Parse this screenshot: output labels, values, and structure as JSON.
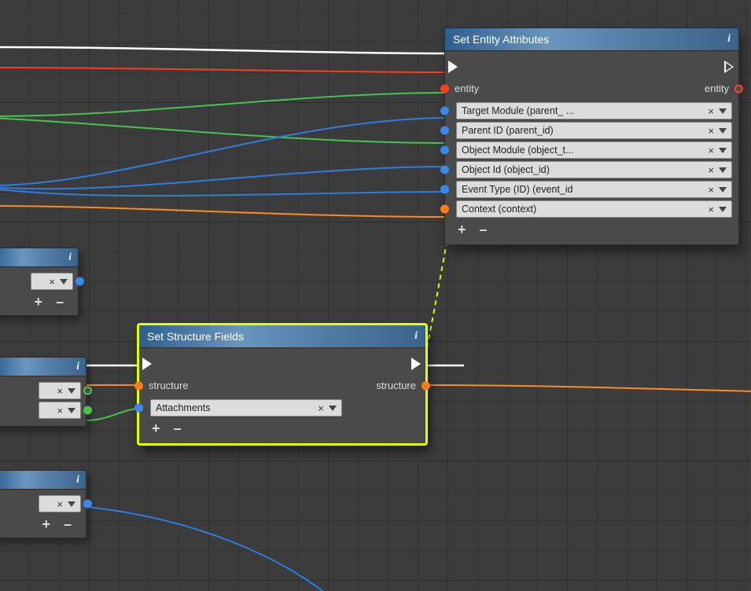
{
  "nodes": {
    "setEntity": {
      "title": "Set Entity Attributes",
      "entity_in": "entity",
      "entity_out": "entity",
      "props": [
        "Target Module (parent_ ...",
        "Parent ID (parent_id)",
        "Object Module (object_t...",
        "Object Id (object_id)",
        "Event Type (ID) (event_id",
        "Context (context)"
      ]
    },
    "setStruct": {
      "title": "Set Structure Fields",
      "structure_in": "structure",
      "structure_out": "structure",
      "props": [
        "Attachments"
      ]
    }
  },
  "addremove": "+  –",
  "x_label": "×"
}
